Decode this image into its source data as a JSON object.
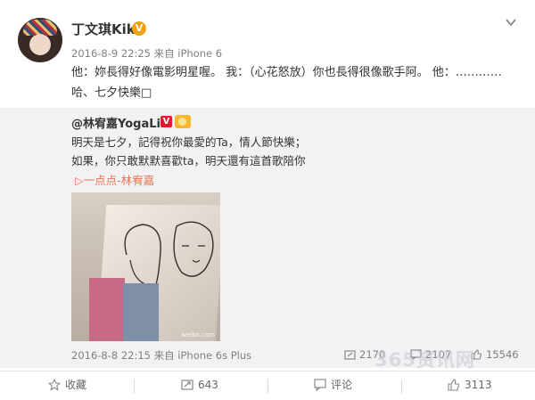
{
  "post": {
    "user_name": "丁文琪Kiki",
    "vip_badge": "V",
    "meta": "2016-8-9 22:25 来自 iPhone 6",
    "text": "他：妳長得好像電影明星喔。 我：（心花怒放）你也長得很像歌手阿。 他：………… 哈、七夕快樂□"
  },
  "repost": {
    "author": "@林宥嘉YogaLin",
    "author_badge": "V",
    "text_line1": "明天是七夕，記得祝你最愛的Ta，情人節快樂；",
    "text_line2": "如果，你只敢默默喜歡ta，明天還有這首歌陪你",
    "music_link": "▷一点点-林宥嘉",
    "image_watermark": "weibo.com",
    "meta": "2016-8-8 22:15 来自 iPhone 6s Plus",
    "stats": {
      "reposts": "2170",
      "comments": "2107",
      "likes": "15546"
    }
  },
  "site_watermark": "365资讯网",
  "footer": {
    "favorite_label": "收藏",
    "repost_count": "643",
    "comment_label": "评论",
    "like_count": "3113"
  },
  "colors": {
    "link": "#eb7350",
    "meta": "#808080",
    "repost_bg": "#f2f2f5",
    "vip": "#f2a20b",
    "verified_red": "#e6162d"
  }
}
